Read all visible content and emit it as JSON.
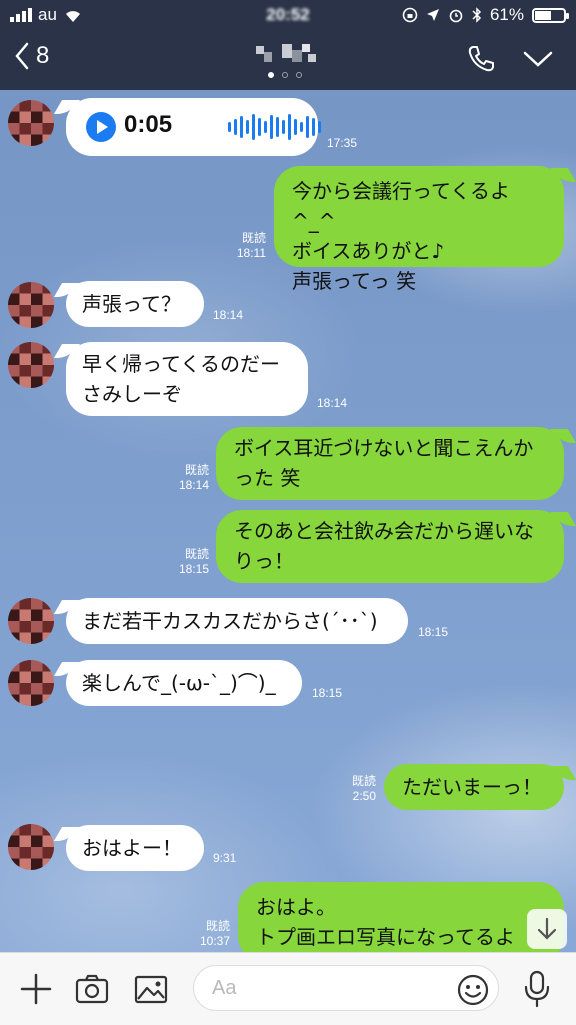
{
  "status_bar": {
    "carrier": "au",
    "battery": "61%",
    "battery_level": 0.61
  },
  "header": {
    "back_count": "8"
  },
  "messages": [
    {
      "side": "in",
      "type": "voice",
      "duration": "0:05",
      "time": "17:35"
    },
    {
      "side": "out",
      "lines": [
        "今から会議行ってくるよ^_^",
        "ボイスありがと♪",
        "声張ってっ 笑"
      ],
      "read": "既読",
      "time": "18:11"
    },
    {
      "side": "in",
      "lines": [
        "声張って？"
      ],
      "time": "18:14"
    },
    {
      "side": "in",
      "lines": [
        "早く帰ってくるのだー",
        "さみしーぞ"
      ],
      "time": "18:14"
    },
    {
      "side": "out",
      "lines": [
        "ボイス耳近づけないと聞こえんか",
        "った 笑"
      ],
      "read": "既読",
      "time": "18:14"
    },
    {
      "side": "out",
      "lines": [
        "そのあと会社飲み会だから遅いな",
        "りっ！"
      ],
      "read": "既読",
      "time": "18:15"
    },
    {
      "side": "in",
      "lines": [
        "まだ若干カスカスだからさ(´･･`)"
      ],
      "time": "18:15"
    },
    {
      "side": "in",
      "lines": [
        "楽しんで_(-ω-`_)⌒)_"
      ],
      "time": "18:15"
    },
    {
      "side": "out",
      "lines": [
        "ただいまーっ！"
      ],
      "read": "既読",
      "time": "2:50"
    },
    {
      "side": "in",
      "lines": [
        "おはよー！"
      ],
      "time": "9:31"
    },
    {
      "side": "out",
      "lines": [
        "おはよ。",
        "トプ画エロ写真になってるよ"
      ],
      "read": "既読",
      "time": "10:37"
    }
  ],
  "input_bar": {
    "placeholder": "Aa",
    "icons": [
      "plus-icon",
      "camera-icon",
      "image-icon",
      "emoji-icon",
      "microphone-icon"
    ]
  },
  "colors": {
    "header_bg": "#2a3347",
    "outgoing_bubble": "#86d63c",
    "incoming_bubble": "#ffffff",
    "accent_blue": "#1b7cf2"
  }
}
